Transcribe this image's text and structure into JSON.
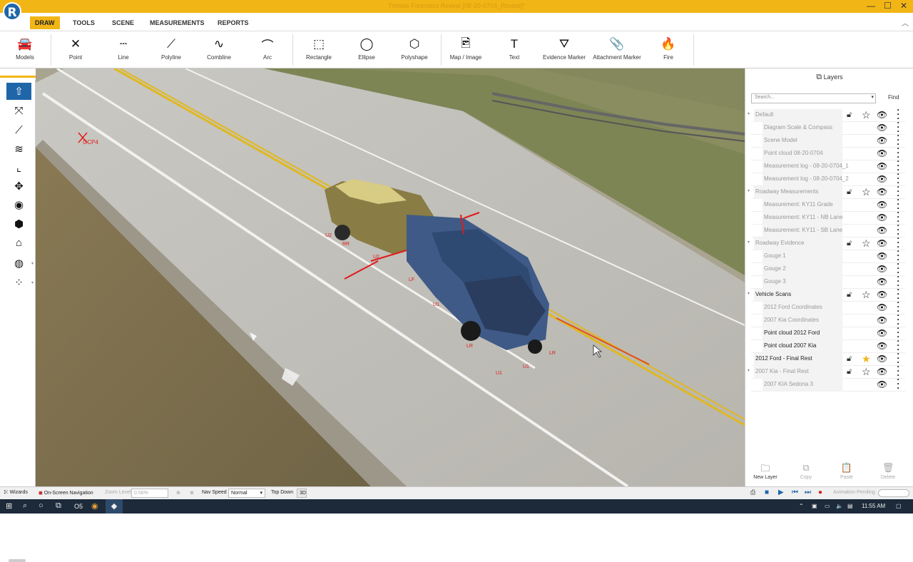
{
  "title_bar": {
    "title": "Trimble Forensics Reveal [08-20-0704_Reveal]*"
  },
  "logo_letter": "R",
  "window_controls": {
    "minimize": "—",
    "maximize": "☐",
    "close": "✕"
  },
  "tabs": [
    "DRAW",
    "TOOLS",
    "SCENE",
    "MEASUREMENTS",
    "REPORTS"
  ],
  "ribbon": [
    {
      "label": "Models",
      "icon": "car-icon",
      "glyph": "🚘"
    },
    {
      "label": "Point",
      "icon": "point-icon",
      "glyph": "✕"
    },
    {
      "label": "Line",
      "icon": "line-icon",
      "glyph": "┄"
    },
    {
      "label": "Polyline",
      "icon": "polyline-icon",
      "glyph": "⟋"
    },
    {
      "label": "Combline",
      "icon": "combline-icon",
      "glyph": "∿"
    },
    {
      "label": "Arc",
      "icon": "arc-icon",
      "glyph": "⌒"
    },
    {
      "label": "Rectangle",
      "icon": "rectangle-icon",
      "glyph": "⬚"
    },
    {
      "label": "Ellipse",
      "icon": "ellipse-icon",
      "glyph": "◯"
    },
    {
      "label": "Polyshape",
      "icon": "polyshape-icon",
      "glyph": "⬡"
    },
    {
      "label": "Map / Image",
      "icon": "image-icon",
      "glyph": "🖻"
    },
    {
      "label": "Text",
      "icon": "text-icon",
      "glyph": "T"
    },
    {
      "label": "Evidence Marker",
      "icon": "evidence-marker-icon",
      "glyph": "⛛"
    },
    {
      "label": "Attachment Marker",
      "icon": "paperclip-icon",
      "glyph": "📎"
    },
    {
      "label": "Fire",
      "icon": "fire-icon",
      "glyph": "🔥"
    }
  ],
  "left_tools": [
    {
      "name": "navigate-tool",
      "icon": "arrow-up-icon",
      "glyph": "⇧",
      "active": true
    },
    {
      "name": "scale-tool",
      "icon": "cross-arrows-icon",
      "glyph": "⤧"
    },
    {
      "name": "line-measure-tool",
      "icon": "diagonal-line-icon",
      "glyph": "⟋"
    },
    {
      "name": "road-tool",
      "icon": "road-icon",
      "glyph": "≋"
    },
    {
      "name": "crop-tool",
      "icon": "crop-icon",
      "glyph": "⌞"
    },
    {
      "name": "move-tool",
      "icon": "move-icon",
      "glyph": "✥"
    },
    {
      "name": "camera-tool",
      "icon": "eye-icon",
      "glyph": "◉"
    },
    {
      "name": "cube-tool",
      "icon": "cube-icon",
      "glyph": "⬢"
    },
    {
      "name": "model-tool",
      "icon": "vehicle-outline-icon",
      "glyph": "⌂"
    },
    {
      "name": "globe-tool",
      "icon": "globe-icon",
      "glyph": "◍"
    },
    {
      "name": "points-tool",
      "icon": "points-icon",
      "glyph": "⁘"
    }
  ],
  "scene_labels": [
    {
      "text": "GCP4"
    },
    {
      "text": "U2"
    },
    {
      "text": "RR"
    },
    {
      "text": "U2"
    },
    {
      "text": "LF"
    },
    {
      "text": "U1"
    },
    {
      "text": "LR"
    },
    {
      "text": "U1"
    },
    {
      "text": "U1"
    },
    {
      "text": "LR"
    }
  ],
  "layers_panel": {
    "title": "Layers",
    "search_placeholder": "Search...",
    "find_label": "Find",
    "rows": [
      {
        "name": "Default",
        "group": true,
        "lock": true,
        "star": true,
        "on": false
      },
      {
        "name": "Diagram Scale & Compass",
        "on": false
      },
      {
        "name": "Scene Model",
        "on": false
      },
      {
        "name": "Point cloud 08-20-0704",
        "on": false
      },
      {
        "name": "Measurement log - 08-20-0704_1",
        "on": false
      },
      {
        "name": "Measurement log - 08-20-0704_2",
        "on": false
      },
      {
        "name": "Roadway Measurements",
        "group": true,
        "lock": true,
        "star": true,
        "on": false
      },
      {
        "name": "Measurement:  KY11 Grade",
        "on": false
      },
      {
        "name": "Measurement:  KY11 - NB Lane",
        "on": false
      },
      {
        "name": "Measurement:  KY11 - SB Lane",
        "on": false
      },
      {
        "name": "Roadway Evidence",
        "group": true,
        "lock": true,
        "star": true,
        "on": false
      },
      {
        "name": "Gouge 1",
        "on": false
      },
      {
        "name": "Gouge 2",
        "on": false
      },
      {
        "name": "Gouge 3",
        "on": false
      },
      {
        "name": "Vehicle Scans",
        "group": true,
        "lock": true,
        "star": true,
        "on": true
      },
      {
        "name": "2012 Ford Coordinates",
        "on": false
      },
      {
        "name": "2007 Kia Coordinates",
        "on": false
      },
      {
        "name": "Point cloud 2012 Ford",
        "on": true
      },
      {
        "name": "Point cloud 2007 Kia",
        "on": true
      },
      {
        "name": "2012 Ford - Final Rest",
        "top": true,
        "lock": true,
        "star": true,
        "gold": true,
        "on": true
      },
      {
        "name": "2007 Kia - Final Rest",
        "group": true,
        "lock": true,
        "star": true,
        "on": false
      },
      {
        "name": "2007 KIA Sedona 3",
        "on": false
      }
    ],
    "footer": [
      {
        "label": "New Layer",
        "icon": "folder-icon",
        "glyph": "🗀",
        "enabled": true
      },
      {
        "label": "Copy",
        "icon": "copy-icon",
        "glyph": "⧉",
        "enabled": false
      },
      {
        "label": "Paste",
        "icon": "paste-icon",
        "glyph": "📋",
        "enabled": false
      },
      {
        "label": "Delete",
        "icon": "trash-icon",
        "glyph": "🗑",
        "enabled": false
      }
    ]
  },
  "status_bar": {
    "wizards": "Wizards",
    "onscreen_nav": "On-Screen Navigation",
    "zoom_label": "Zoom Level",
    "zoom_value": "0.56%",
    "nav_speed_label": "Nav Speed",
    "nav_speed_value": "Normal",
    "top_down": "Top Down",
    "view_3d": "3D",
    "animation_pending": "Animation Pending"
  },
  "taskbar": {
    "time": "11:55 AM"
  },
  "colors": {
    "accent": "#f2b516",
    "active_tool": "#1f66a8",
    "annotation_red": "#e01b1b"
  }
}
